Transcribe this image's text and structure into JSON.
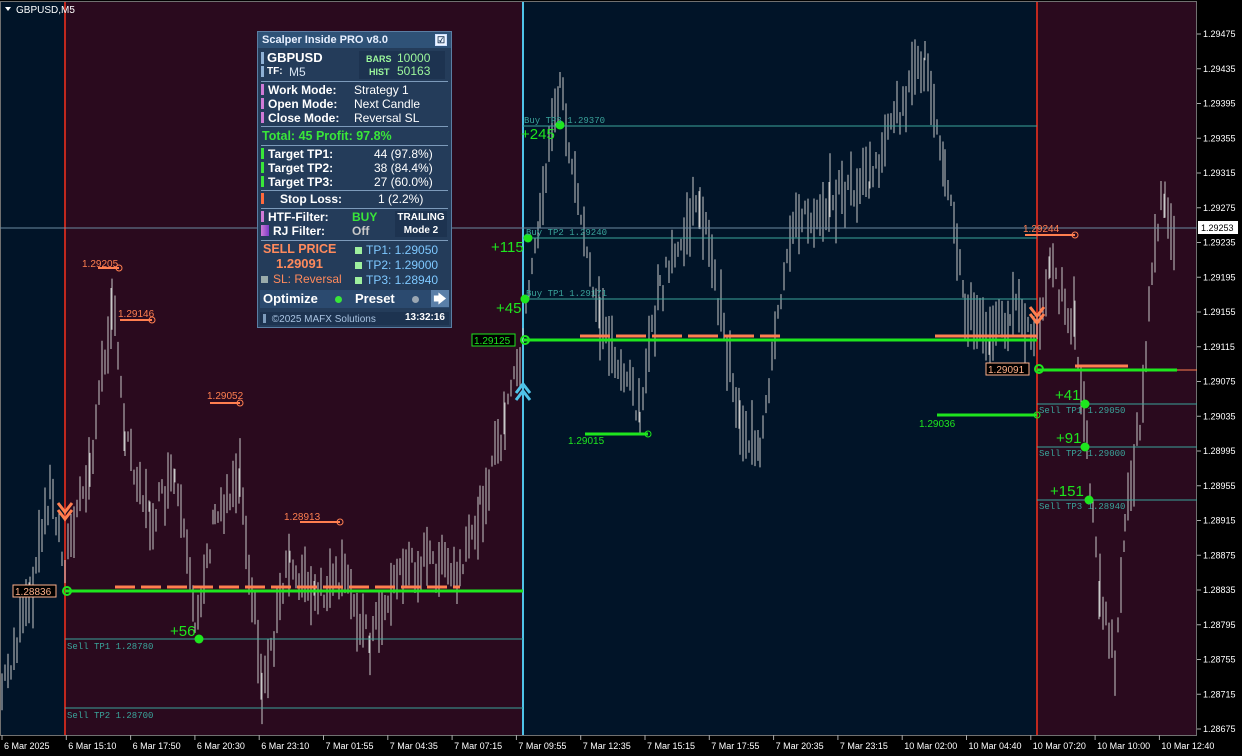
{
  "chart": {
    "symbol_label": "GBPUSD,M5",
    "price_ticks": [
      "1.29475",
      "1.29435",
      "1.29395",
      "1.29355",
      "1.29315",
      "1.29275",
      "1.29235",
      "1.29195",
      "1.29155",
      "1.29115",
      "1.29075",
      "1.29035",
      "1.28995",
      "1.28955",
      "1.28915",
      "1.28875",
      "1.28835",
      "1.28795",
      "1.28755",
      "1.28715",
      "1.28675"
    ],
    "current_price": "1.29253",
    "time_ticks": [
      "6 Mar 2025",
      "6 Mar 15:10",
      "6 Mar 17:50",
      "6 Mar 20:30",
      "6 Mar 23:10",
      "7 Mar 01:55",
      "7 Mar 04:35",
      "7 Mar 07:15",
      "7 Mar 09:55",
      "7 Mar 12:35",
      "7 Mar 15:15",
      "7 Mar 17:55",
      "7 Mar 20:35",
      "7 Mar 23:15",
      "10 Mar 02:00",
      "10 Mar 04:40",
      "10 Mar 07:20",
      "10 Mar 10:00",
      "10 Mar 12:40"
    ],
    "colors": {
      "bg": "#000000",
      "sell_zone": "#2a0a1e",
      "buy_zone": "#011428",
      "candle": "#c8c8c8",
      "green": "#1ee61e",
      "orange": "#ff7f50",
      "teal": "#3aa39a",
      "cyan": "#4fc3e8",
      "red": "#c0281e"
    },
    "labels": {
      "sell1_entry": "1.28836",
      "buy_entry": "1.29125",
      "sell2_entry": "1.29091",
      "h1": "1.29205",
      "h2": "1.29146",
      "h3": "1.29052",
      "h4": "1.28913",
      "h5": "1.29244",
      "l1": "1.29015",
      "l2": "1.29036",
      "p_sell1_tp1": "+56",
      "p_buy_tp1": "+45",
      "p_buy_tp2": "+115",
      "p_buy_tp3": "+245",
      "p_sell2_tp1": "+41",
      "p_sell2_tp2": "+91",
      "p_sell2_tp3": "+151",
      "sell1_tp1": "Sell TP1 1.28780",
      "sell1_tp2": "Sell TP2 1.28700",
      "buy_tp1": "Buy TP1 1.29171",
      "buy_tp2": "Buy TP2 1.29240",
      "buy_tp3": "Buy TP3 1.29370",
      "sell2_tp1": "Sell TP1 1.29050",
      "sell2_tp2": "Sell TP2 1.29000",
      "sell2_tp3": "Sell TP3 1.28940"
    }
  },
  "panel": {
    "title": "Scalper Inside PRO v8.0",
    "checkbox_glyph": "☑",
    "symbol": "GBPUSD",
    "tf_label": "TF:",
    "tf_value": "M5",
    "bars_label": "BARS",
    "bars_value": "10000",
    "hist_label": "HIST",
    "hist_value": "50163",
    "work_mode_label": "Work  Mode:",
    "work_mode_value": "Strategy 1",
    "open_mode_label": "Open  Mode:",
    "open_mode_value": "Next Candle",
    "close_mode_label": "Close Mode:",
    "close_mode_value": "Reversal SL",
    "total_line": "Total: 45  Profit: 97.8%",
    "tp1_label": "Target TP1:",
    "tp1_value": "44 (97.8%)",
    "tp2_label": "Target TP2:",
    "tp2_value": "38 (84.4%)",
    "tp3_label": "Target TP3:",
    "tp3_value": "27 (60.0%)",
    "sl_label": "Stop Loss:",
    "sl_value": "1 (2.2%)",
    "htf_label": "HTF-Filter:",
    "htf_value": "BUY",
    "rj_label": "RJ Filter:",
    "rj_value": "Off",
    "trailing_label": "TRAILING",
    "trailing_mode": "Mode 2",
    "sell_price_label": "SELL PRICE",
    "sell_price_value": "1.29091",
    "sl_reversal": "SL: Reversal",
    "tp1_price": "TP1: 1.29050",
    "tp2_price": "TP2: 1.29000",
    "tp3_price": "TP3: 1.28940",
    "optimize_label": "Optimize",
    "preset_label": "Preset",
    "arrow_glyph": "🡆",
    "copyright": "©2025 MAFX Solutions",
    "clock": "13:32:16"
  }
}
